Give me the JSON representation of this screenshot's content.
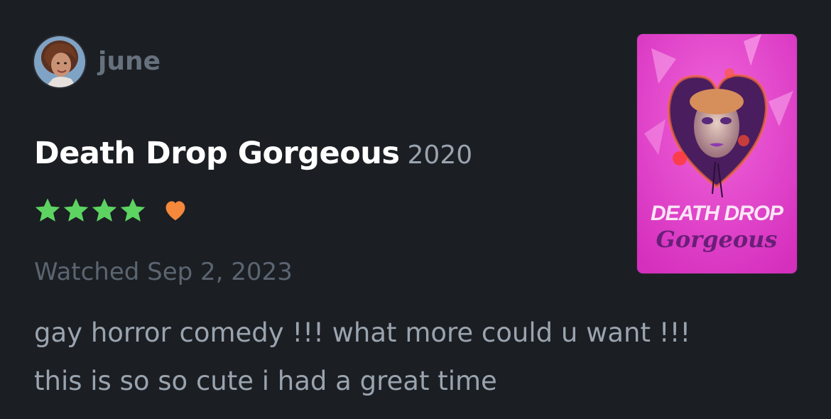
{
  "user": {
    "username": "june",
    "avatar_icon": "user-avatar"
  },
  "film": {
    "title": "Death Drop Gorgeous",
    "year": "2020",
    "poster_title_line1": "DEATH DROP",
    "poster_title_line2": "Gorgeous"
  },
  "rating": {
    "stars": 4,
    "max_stars": 5,
    "liked": true,
    "star_color": "#5dd362",
    "heart_color": "#f5883b"
  },
  "watched": "Watched Sep 2, 2023",
  "review": {
    "line1": "gay horror comedy !!! what more could u want !!!",
    "line2": "this is so so cute i had a great time"
  },
  "colors": {
    "background": "#1b1e23",
    "title": "#ffffff",
    "muted": "#9aa4af",
    "username": "#66717d",
    "poster_pink": "#e13fc8"
  }
}
